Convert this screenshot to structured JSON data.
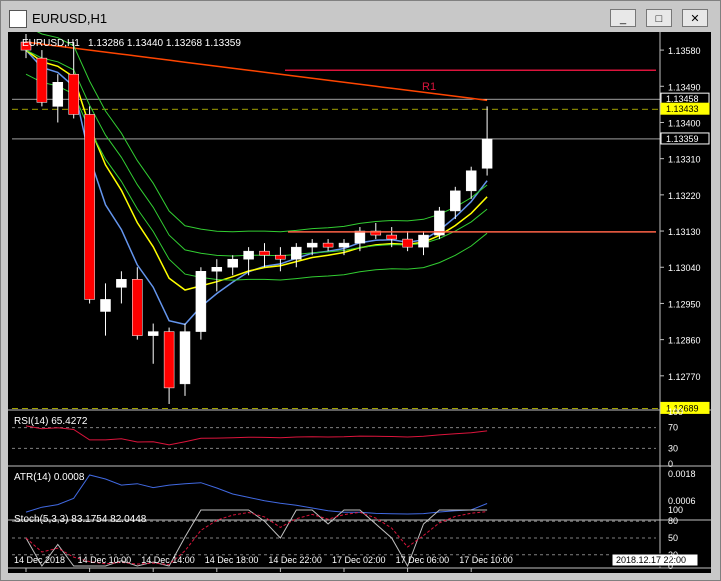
{
  "window": {
    "title": "EURUSD,H1",
    "buttons": [
      "_",
      "□",
      "✕"
    ]
  },
  "chart_data": [
    {
      "type": "candlestick",
      "title": "EURUSD,H1",
      "ohlc_label": "1.13286 1.13440 1.13268 1.13359",
      "ylim": [
        1.1269,
        1.1362
      ],
      "y_ticks": [
        "1.13580",
        "1.13490",
        "1.13400",
        "1.13310",
        "1.13220",
        "1.13130",
        "1.13040",
        "1.12950",
        "1.12860",
        "1.12770"
      ],
      "price_tags": [
        {
          "value": "1.13458",
          "color": "#ffffff"
        },
        {
          "value": "1.13433",
          "color": "#ffff00"
        },
        {
          "value": "1.13359",
          "color": "#ffffff"
        },
        {
          "value": "1.12689",
          "color": "#ffff00"
        }
      ],
      "resistance_label": "R1",
      "resistance_level": 1.1353,
      "support_level": 1.13128,
      "candles": [
        [
          1.136,
          1.1362,
          1.1356,
          1.1358
        ],
        [
          1.1356,
          1.1358,
          1.1344,
          1.1345
        ],
        [
          1.1344,
          1.1352,
          1.134,
          1.135
        ],
        [
          1.1352,
          1.136,
          1.1341,
          1.1342
        ],
        [
          1.1342,
          1.1344,
          1.1295,
          1.1296
        ],
        [
          1.1293,
          1.13,
          1.1287,
          1.1296
        ],
        [
          1.1299,
          1.1303,
          1.1295,
          1.1301
        ],
        [
          1.1301,
          1.1304,
          1.1286,
          1.1287
        ],
        [
          1.1287,
          1.129,
          1.128,
          1.1288
        ],
        [
          1.1288,
          1.1289,
          1.127,
          1.1274
        ],
        [
          1.1275,
          1.129,
          1.1272,
          1.1288
        ],
        [
          1.1288,
          1.1304,
          1.1286,
          1.1303
        ],
        [
          1.1303,
          1.1306,
          1.1298,
          1.1304
        ],
        [
          1.1304,
          1.1307,
          1.1302,
          1.1306
        ],
        [
          1.1306,
          1.1309,
          1.1302,
          1.1308
        ],
        [
          1.1308,
          1.131,
          1.1304,
          1.1307
        ],
        [
          1.1307,
          1.1309,
          1.1303,
          1.1306
        ],
        [
          1.1306,
          1.131,
          1.1304,
          1.1309
        ],
        [
          1.1309,
          1.1311,
          1.1307,
          1.131
        ],
        [
          1.131,
          1.1311,
          1.1308,
          1.1309
        ],
        [
          1.1309,
          1.1311,
          1.1307,
          1.131
        ],
        [
          1.131,
          1.1314,
          1.1308,
          1.1313
        ],
        [
          1.1313,
          1.1315,
          1.1311,
          1.1312
        ],
        [
          1.1312,
          1.1314,
          1.1309,
          1.1311
        ],
        [
          1.1311,
          1.1313,
          1.1308,
          1.1309
        ],
        [
          1.1309,
          1.1313,
          1.1307,
          1.1312
        ],
        [
          1.1312,
          1.1319,
          1.1311,
          1.1318
        ],
        [
          1.1318,
          1.1324,
          1.1316,
          1.1323
        ],
        [
          1.1323,
          1.1329,
          1.1321,
          1.1328
        ],
        [
          1.13286,
          1.1344,
          1.13268,
          1.13359
        ]
      ],
      "x_ticks": [
        "14 Dec 2018",
        "14 Dec 10:00",
        "14 Dec 14:00",
        "14 Dec 18:00",
        "14 Dec 22:00",
        "17 Dec 02:00",
        "17 Dec 06:00",
        "17 Dec 10:00"
      ],
      "time_tag": "2018.12.17 22:00"
    },
    {
      "type": "line",
      "title": "RSI(14) 65.4272",
      "ylim": [
        0,
        100
      ],
      "y_ticks": [
        "100",
        "70",
        "30",
        "0"
      ],
      "levels": [
        70,
        30
      ]
    },
    {
      "type": "line",
      "title": "ATR(14) 0.0008",
      "y_ticks": [
        "0.0018",
        "0.0006"
      ]
    },
    {
      "type": "line",
      "title": "Stoch(5,3,3) 83.1754 82.0448",
      "ylim": [
        0,
        100
      ],
      "y_ticks": [
        "100",
        "80",
        "50",
        "20",
        "0"
      ],
      "levels": [
        80,
        50,
        20
      ]
    }
  ],
  "colors": {
    "bull": "#ffffff",
    "bear": "#ff0000",
    "yellow_ma": "#ffff00",
    "blue_ma": "#6495ed",
    "orange_ma": "#ff4500",
    "bands": "#32cd32",
    "resistance": "#dc143c",
    "support": "#ff6347"
  }
}
